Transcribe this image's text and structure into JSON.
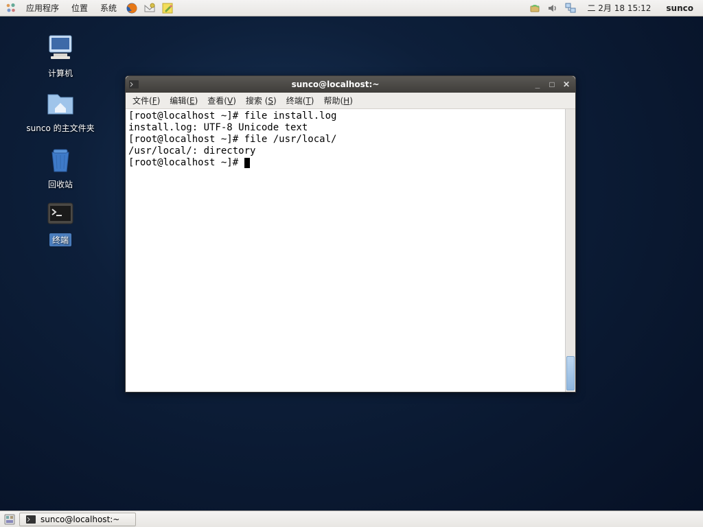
{
  "panel": {
    "apps": "应用程序",
    "places": "位置",
    "system": "系统",
    "clock": "二 2月 18 15:12",
    "user": "sunco"
  },
  "desktop": {
    "computer": "计算机",
    "home": "sunco 的主文件夹",
    "trash": "回收站",
    "terminal": "终端"
  },
  "window": {
    "title": "sunco@localhost:~",
    "menu": {
      "file": "文件",
      "edit": "编辑",
      "view": "查看",
      "search": "搜索",
      "terminal": "终端",
      "help": "帮助"
    },
    "menukey": {
      "file": "F",
      "edit": "E",
      "view": "V",
      "search": "S",
      "terminal": "T",
      "help": "H"
    },
    "lines": [
      "[root@localhost ~]# file install.log",
      "install.log: UTF-8 Unicode text",
      "[root@localhost ~]# file /usr/local/",
      "/usr/local/: directory",
      "[root@localhost ~]# "
    ]
  },
  "taskbar": {
    "task": "sunco@localhost:~"
  }
}
